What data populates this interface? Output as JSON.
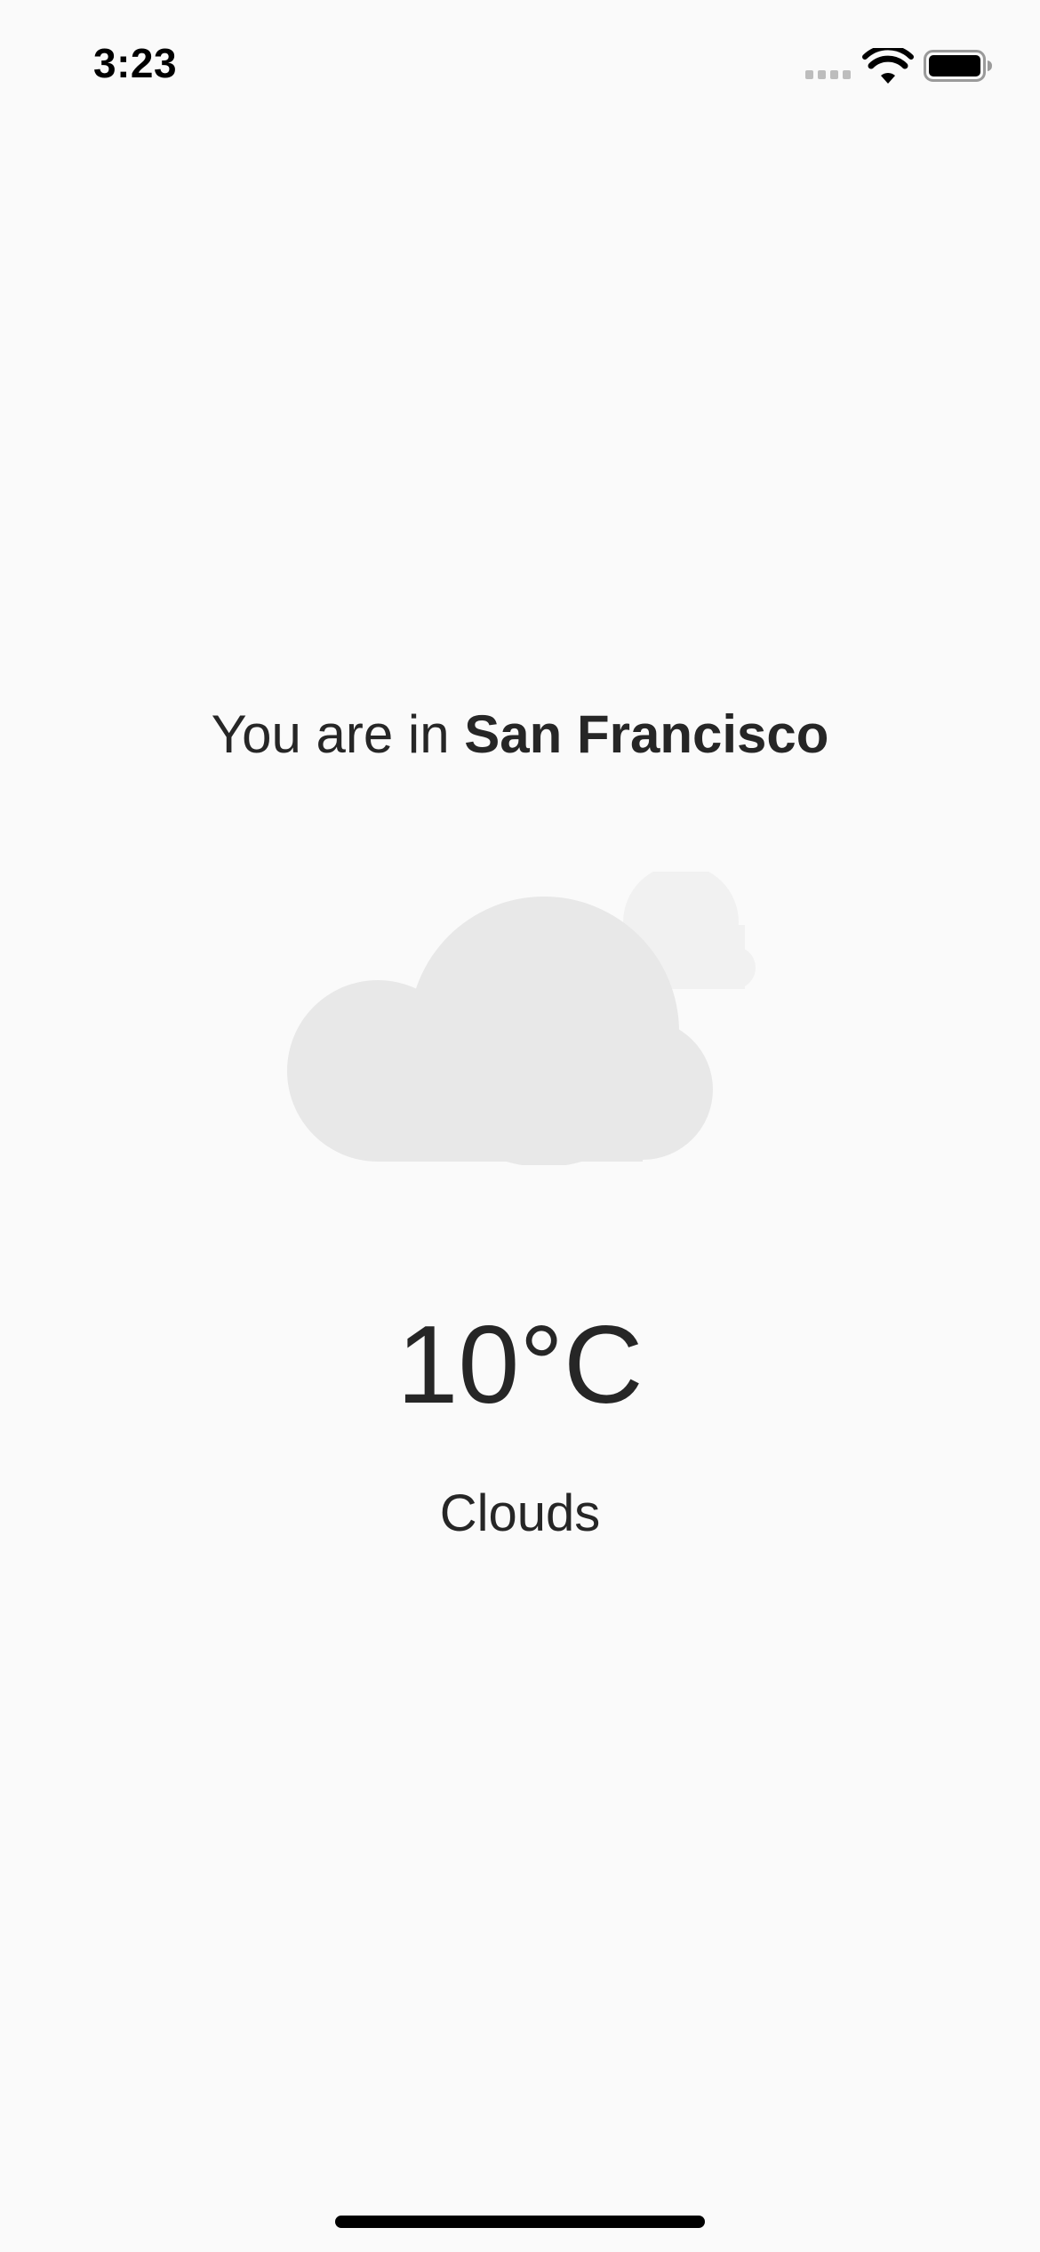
{
  "status_bar": {
    "time": "3:23",
    "icons": {
      "signal": "cellular-signal-icon",
      "wifi": "wifi-icon",
      "battery": "battery-icon"
    }
  },
  "location": {
    "prefix": "You are in ",
    "city": "San Francisco"
  },
  "weather": {
    "icon": "cloud-icon",
    "temperature": "10°C",
    "condition": "Clouds"
  },
  "colors": {
    "background": "#fafafa",
    "text": "#262626",
    "cloud_front": "#e8e8e8",
    "cloud_back": "#f1f1f1"
  }
}
